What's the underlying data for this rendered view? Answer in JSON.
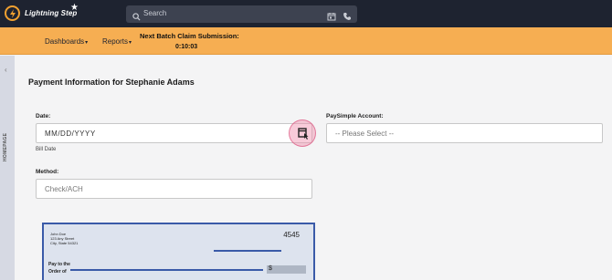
{
  "app": {
    "name": "Lightning Step"
  },
  "search": {
    "placeholder": "Search"
  },
  "nav": {
    "items": [
      {
        "label": "Dashboards"
      },
      {
        "label": "Reports"
      }
    ]
  },
  "batch": {
    "label": "Next Batch Claim Submission:",
    "time": "0:10:03"
  },
  "sidebar": {
    "label": "HOMEPAGE"
  },
  "form": {
    "title": "Payment Information for Stephanie Adams",
    "date_label": "Date:",
    "date_placeholder": "MM/DD/YYYY",
    "date_hint": "Bill Date",
    "method_label": "Method:",
    "method_value": "Check/ACH",
    "paysimple_label": "PaySimple Account:",
    "paysimple_value": "-- Please Select --"
  },
  "check": {
    "name": "John Doe",
    "street": "123 Any Street",
    "city": "City, State 54321",
    "number": "4545",
    "pay_to": "Pay to the",
    "order_of": "Order of",
    "currency": "$"
  },
  "colors": {
    "topbar": "#1e2330",
    "accent": "#f6ae52",
    "check_border": "#3a5aa8"
  }
}
